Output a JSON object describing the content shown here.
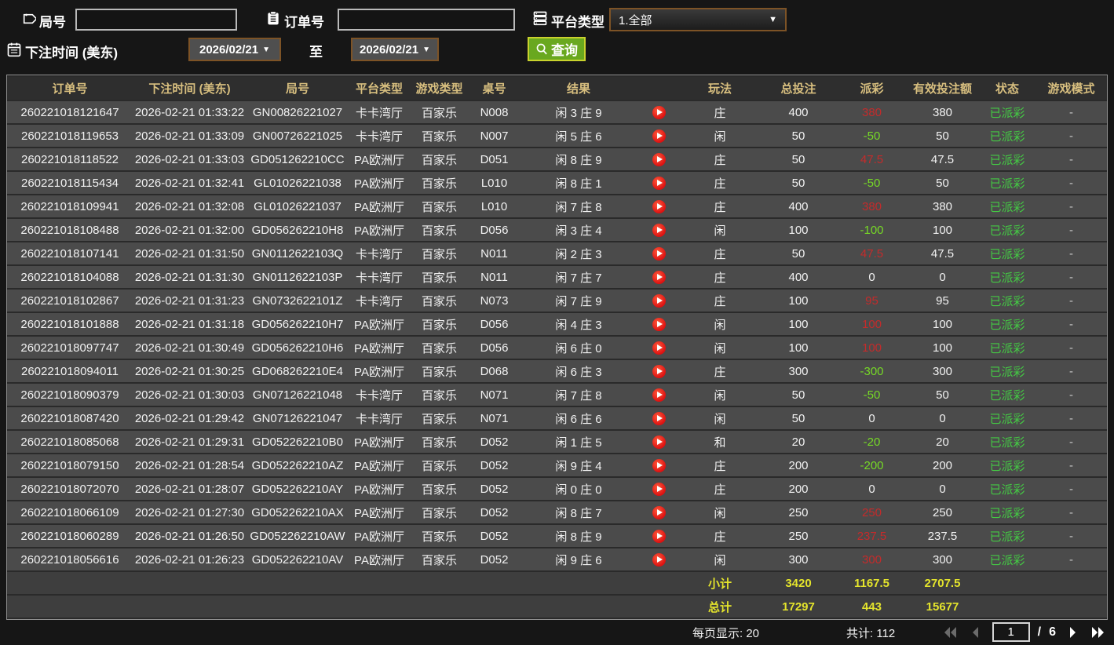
{
  "filters": {
    "game_no_label": "局号",
    "order_no_label": "订单号",
    "platform_label": "平台类型",
    "platform_value": "1.全部",
    "bet_time_label": "下注时间 (美东)",
    "date_from": "2026/02/21",
    "date_to": "2026/02/21",
    "to_label": "至",
    "search_label": "查询"
  },
  "table": {
    "headers": [
      "订单号",
      "下注时间 (美东)",
      "局号",
      "平台类型",
      "游戏类型",
      "桌号",
      "结果",
      "",
      "玩法",
      "总投注",
      "派彩",
      "有效投注额",
      "状态",
      "游戏模式"
    ],
    "rows": [
      {
        "order": "260221018121647",
        "time": "2026-02-21 01:33:22",
        "game": "GN00826221027",
        "platform": "卡卡湾厅",
        "type": "百家乐",
        "tableno": "N008",
        "result": "闲 3 庄 9",
        "play": "庄",
        "bet": "400",
        "payout": "380",
        "payout_class": "pos",
        "valid": "380",
        "status": "已派彩",
        "mode": "-"
      },
      {
        "order": "260221018119653",
        "time": "2026-02-21 01:33:09",
        "game": "GN00726221025",
        "platform": "卡卡湾厅",
        "type": "百家乐",
        "tableno": "N007",
        "result": "闲 5 庄 6",
        "play": "闲",
        "bet": "50",
        "payout": "-50",
        "payout_class": "neg",
        "valid": "50",
        "status": "已派彩",
        "mode": "-"
      },
      {
        "order": "260221018118522",
        "time": "2026-02-21 01:33:03",
        "game": "GD051262210CC",
        "platform": "PA欧洲厅",
        "type": "百家乐",
        "tableno": "D051",
        "result": "闲 8 庄 9",
        "play": "庄",
        "bet": "50",
        "payout": "47.5",
        "payout_class": "pos",
        "valid": "47.5",
        "status": "已派彩",
        "mode": "-"
      },
      {
        "order": "260221018115434",
        "time": "2026-02-21 01:32:41",
        "game": "GL01026221038",
        "platform": "PA欧洲厅",
        "type": "百家乐",
        "tableno": "L010",
        "result": "闲 8 庄 1",
        "play": "庄",
        "bet": "50",
        "payout": "-50",
        "payout_class": "neg",
        "valid": "50",
        "status": "已派彩",
        "mode": "-"
      },
      {
        "order": "260221018109941",
        "time": "2026-02-21 01:32:08",
        "game": "GL01026221037",
        "platform": "PA欧洲厅",
        "type": "百家乐",
        "tableno": "L010",
        "result": "闲 7 庄 8",
        "play": "庄",
        "bet": "400",
        "payout": "380",
        "payout_class": "pos",
        "valid": "380",
        "status": "已派彩",
        "mode": "-"
      },
      {
        "order": "260221018108488",
        "time": "2026-02-21 01:32:00",
        "game": "GD056262210H8",
        "platform": "PA欧洲厅",
        "type": "百家乐",
        "tableno": "D056",
        "result": "闲 3 庄 4",
        "play": "闲",
        "bet": "100",
        "payout": "-100",
        "payout_class": "neg",
        "valid": "100",
        "status": "已派彩",
        "mode": "-"
      },
      {
        "order": "260221018107141",
        "time": "2026-02-21 01:31:50",
        "game": "GN0112622103Q",
        "platform": "卡卡湾厅",
        "type": "百家乐",
        "tableno": "N011",
        "result": "闲 2 庄 3",
        "play": "庄",
        "bet": "50",
        "payout": "47.5",
        "payout_class": "pos",
        "valid": "47.5",
        "status": "已派彩",
        "mode": "-"
      },
      {
        "order": "260221018104088",
        "time": "2026-02-21 01:31:30",
        "game": "GN0112622103P",
        "platform": "卡卡湾厅",
        "type": "百家乐",
        "tableno": "N011",
        "result": "闲 7 庄 7",
        "play": "庄",
        "bet": "400",
        "payout": "0",
        "payout_class": "zero",
        "valid": "0",
        "status": "已派彩",
        "mode": "-"
      },
      {
        "order": "260221018102867",
        "time": "2026-02-21 01:31:23",
        "game": "GN0732622101Z",
        "platform": "卡卡湾厅",
        "type": "百家乐",
        "tableno": "N073",
        "result": "闲 7 庄 9",
        "play": "庄",
        "bet": "100",
        "payout": "95",
        "payout_class": "pos",
        "valid": "95",
        "status": "已派彩",
        "mode": "-"
      },
      {
        "order": "260221018101888",
        "time": "2026-02-21 01:31:18",
        "game": "GD056262210H7",
        "platform": "PA欧洲厅",
        "type": "百家乐",
        "tableno": "D056",
        "result": "闲 4 庄 3",
        "play": "闲",
        "bet": "100",
        "payout": "100",
        "payout_class": "pos",
        "valid": "100",
        "status": "已派彩",
        "mode": "-"
      },
      {
        "order": "260221018097747",
        "time": "2026-02-21 01:30:49",
        "game": "GD056262210H6",
        "platform": "PA欧洲厅",
        "type": "百家乐",
        "tableno": "D056",
        "result": "闲 6 庄 0",
        "play": "闲",
        "bet": "100",
        "payout": "100",
        "payout_class": "pos",
        "valid": "100",
        "status": "已派彩",
        "mode": "-"
      },
      {
        "order": "260221018094011",
        "time": "2026-02-21 01:30:25",
        "game": "GD068262210E4",
        "platform": "PA欧洲厅",
        "type": "百家乐",
        "tableno": "D068",
        "result": "闲 6 庄 3",
        "play": "庄",
        "bet": "300",
        "payout": "-300",
        "payout_class": "neg",
        "valid": "300",
        "status": "已派彩",
        "mode": "-"
      },
      {
        "order": "260221018090379",
        "time": "2026-02-21 01:30:03",
        "game": "GN07126221048",
        "platform": "卡卡湾厅",
        "type": "百家乐",
        "tableno": "N071",
        "result": "闲 7 庄 8",
        "play": "闲",
        "bet": "50",
        "payout": "-50",
        "payout_class": "neg",
        "valid": "50",
        "status": "已派彩",
        "mode": "-"
      },
      {
        "order": "260221018087420",
        "time": "2026-02-21 01:29:42",
        "game": "GN07126221047",
        "platform": "卡卡湾厅",
        "type": "百家乐",
        "tableno": "N071",
        "result": "闲 6 庄 6",
        "play": "闲",
        "bet": "50",
        "payout": "0",
        "payout_class": "zero",
        "valid": "0",
        "status": "已派彩",
        "mode": "-"
      },
      {
        "order": "260221018085068",
        "time": "2026-02-21 01:29:31",
        "game": "GD052262210B0",
        "platform": "PA欧洲厅",
        "type": "百家乐",
        "tableno": "D052",
        "result": "闲 1 庄 5",
        "play": "和",
        "bet": "20",
        "payout": "-20",
        "payout_class": "neg",
        "valid": "20",
        "status": "已派彩",
        "mode": "-"
      },
      {
        "order": "260221018079150",
        "time": "2026-02-21 01:28:54",
        "game": "GD052262210AZ",
        "platform": "PA欧洲厅",
        "type": "百家乐",
        "tableno": "D052",
        "result": "闲 9 庄 4",
        "play": "庄",
        "bet": "200",
        "payout": "-200",
        "payout_class": "neg",
        "valid": "200",
        "status": "已派彩",
        "mode": "-"
      },
      {
        "order": "260221018072070",
        "time": "2026-02-21 01:28:07",
        "game": "GD052262210AY",
        "platform": "PA欧洲厅",
        "type": "百家乐",
        "tableno": "D052",
        "result": "闲 0 庄 0",
        "play": "庄",
        "bet": "200",
        "payout": "0",
        "payout_class": "zero",
        "valid": "0",
        "status": "已派彩",
        "mode": "-"
      },
      {
        "order": "260221018066109",
        "time": "2026-02-21 01:27:30",
        "game": "GD052262210AX",
        "platform": "PA欧洲厅",
        "type": "百家乐",
        "tableno": "D052",
        "result": "闲 8 庄 7",
        "play": "闲",
        "bet": "250",
        "payout": "250",
        "payout_class": "pos",
        "valid": "250",
        "status": "已派彩",
        "mode": "-"
      },
      {
        "order": "260221018060289",
        "time": "2026-02-21 01:26:50",
        "game": "GD052262210AW",
        "platform": "PA欧洲厅",
        "type": "百家乐",
        "tableno": "D052",
        "result": "闲 8 庄 9",
        "play": "庄",
        "bet": "250",
        "payout": "237.5",
        "payout_class": "pos",
        "valid": "237.5",
        "status": "已派彩",
        "mode": "-"
      },
      {
        "order": "260221018056616",
        "time": "2026-02-21 01:26:23",
        "game": "GD052262210AV",
        "platform": "PA欧洲厅",
        "type": "百家乐",
        "tableno": "D052",
        "result": "闲 9 庄 6",
        "play": "闲",
        "bet": "300",
        "payout": "300",
        "payout_class": "pos",
        "valid": "300",
        "status": "已派彩",
        "mode": "-"
      }
    ],
    "subtotal": {
      "label": "小计",
      "bet": "3420",
      "payout": "1167.5",
      "valid": "2707.5"
    },
    "total": {
      "label": "总计",
      "bet": "17297",
      "payout": "443",
      "valid": "15677"
    }
  },
  "footer": {
    "per_page_label": "每页显示: 20",
    "total_count_label": "共计: 112",
    "page": "1",
    "page_sep": "/",
    "page_total": "6"
  },
  "colors": {
    "payout_positive": "#c42b2b",
    "payout_negative": "#76d926",
    "status_green": "#44c944",
    "totals_yellow": "#e4e42c",
    "header_gold": "#d8bf7f",
    "query_green": "#69a81f",
    "date_border_brown": "#7d5326"
  }
}
